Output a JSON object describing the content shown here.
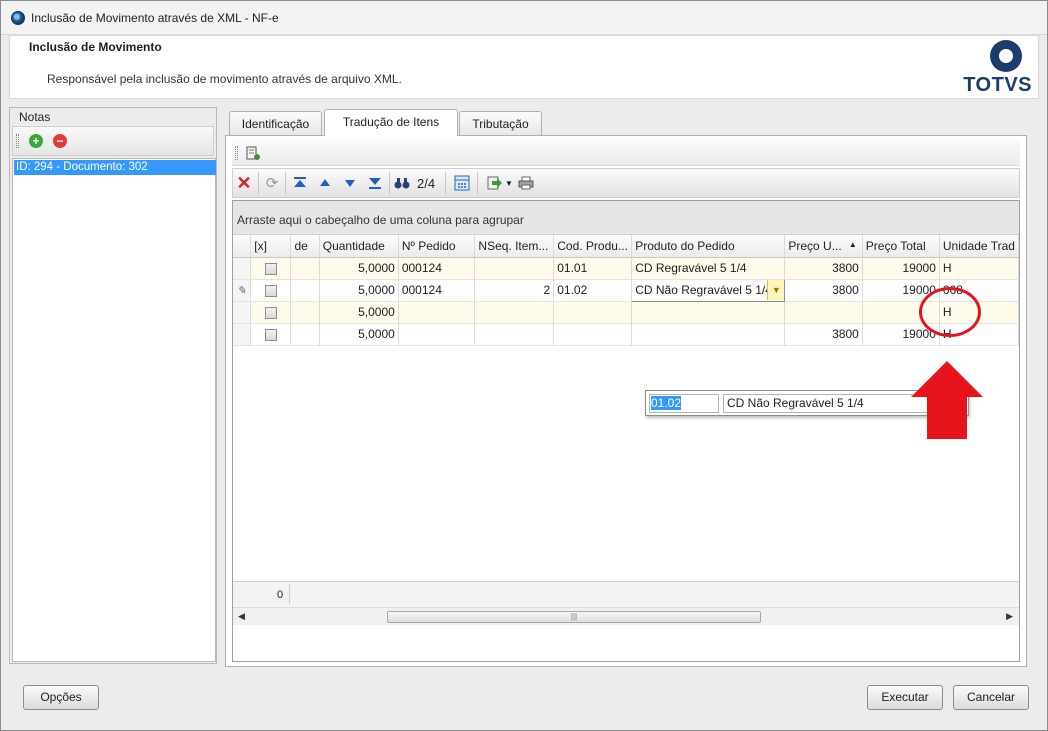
{
  "window": {
    "title": "Inclusão de Movimento através de XML - NF-e"
  },
  "header": {
    "title": "Inclusão de Movimento",
    "description": "Responsável pela inclusão de movimento através de arquivo XML.",
    "logo_text": "TOTVS"
  },
  "notes": {
    "caption": "Notas",
    "items": [
      "ID: 294 - Documento: 302"
    ]
  },
  "tabs": [
    "Identificação",
    "Tradução de Itens",
    "Tributação"
  ],
  "active_tab": "Tradução de Itens",
  "grid_toolbar": {
    "record_counter": "2/4"
  },
  "grid": {
    "group_hint": "Arraste aqui o cabeçalho de uma coluna para agrupar",
    "columns": [
      "[x]",
      "de",
      "Quantidade",
      "Nº Pedido",
      "NSeq. Item...",
      "Cod. Produ...",
      "Produto do Pedido",
      "Preço U...",
      "Preço Total",
      "Unidade Trad"
    ],
    "sort_indicator": "▲",
    "rows": [
      {
        "qty": "5,0000",
        "pedido": "000124",
        "nseq": "",
        "cod": "01.01",
        "produto": "CD Regravável 5 1/4",
        "preco_u": "3800",
        "preco_total": "19000",
        "unidade": "H"
      },
      {
        "qty": "5,0000",
        "pedido": "000124",
        "nseq": "2",
        "cod": "01.02",
        "produto": "CD Não Regravável 5 1/4",
        "preco_u": "3800",
        "preco_total": "19000",
        "unidade": "068"
      },
      {
        "qty": "5,0000",
        "pedido": "",
        "nseq": "",
        "cod": "",
        "produto": "",
        "preco_u": "",
        "preco_total": "",
        "unidade": "H"
      },
      {
        "qty": "5,0000",
        "pedido": "",
        "nseq": "",
        "cod": "",
        "produto": "",
        "preco_u": "3800",
        "preco_total": "19000",
        "unidade": "H"
      }
    ],
    "footer_value": "0"
  },
  "lookup_popup": {
    "code": "01.02",
    "description": "CD Não Regravável 5 1/4",
    "button_label": "..."
  },
  "buttons": {
    "options": "Opções",
    "execute": "Executar",
    "cancel": "Cancelar"
  },
  "colors": {
    "selection": "#3399ff",
    "annotation": "#e8141c",
    "brand": "#1b3c6d"
  }
}
